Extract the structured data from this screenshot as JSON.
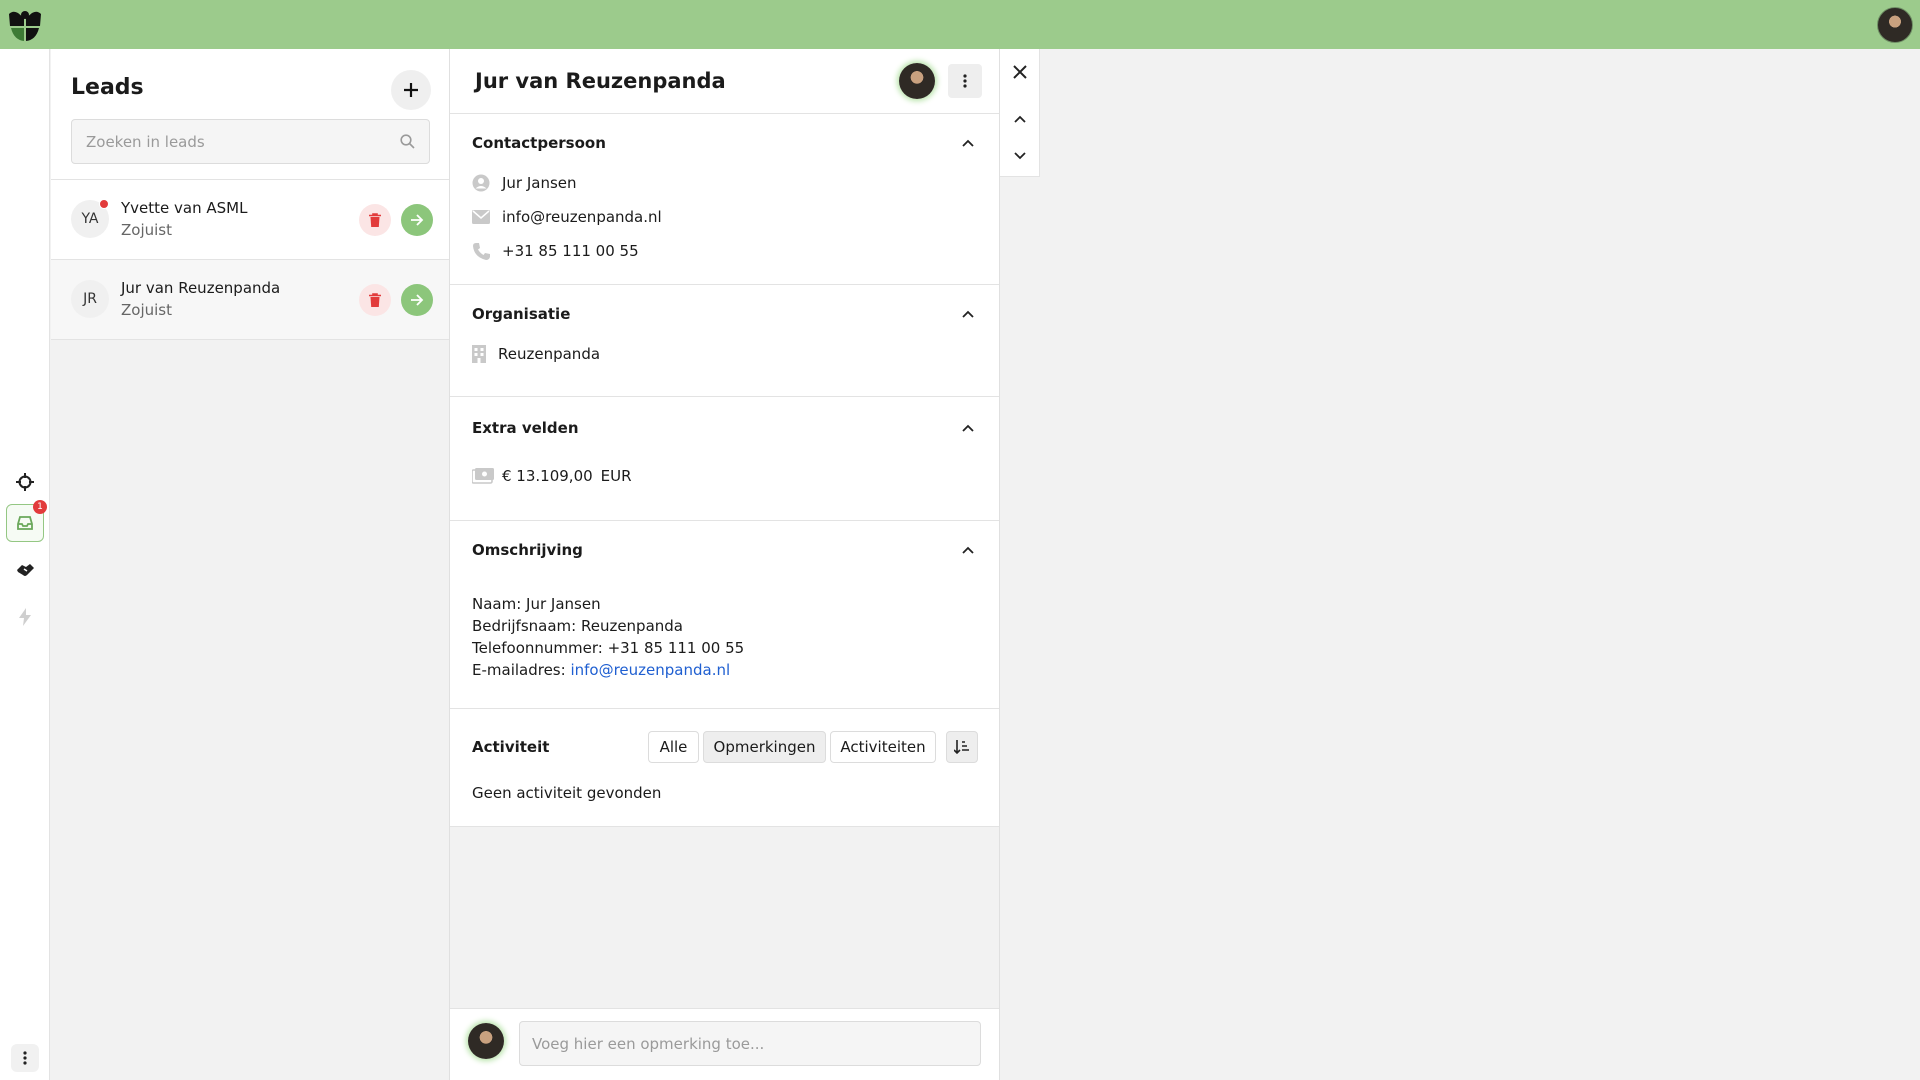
{
  "leads": {
    "title": "Leads",
    "search_placeholder": "Zoeken in leads",
    "items": [
      {
        "initials": "YA",
        "name": "Yvette van ASML",
        "time": "Zojuist",
        "unread": true
      },
      {
        "initials": "JR",
        "name": "Jur van Reuzenpanda",
        "time": "Zojuist",
        "unread": false
      }
    ]
  },
  "rail": {
    "inbox_badge": "1"
  },
  "detail": {
    "title": "Jur van Reuzenpanda",
    "contact": {
      "title": "Contactpersoon",
      "name": "Jur Jansen",
      "email": "info@reuzenpanda.nl",
      "phone": "+31 85 111 00 55"
    },
    "organisation": {
      "title": "Organisatie",
      "name": "Reuzenpanda"
    },
    "extra": {
      "title": "Extra velden",
      "amount": "€ 13.109,00",
      "currency": "EUR"
    },
    "description": {
      "title": "Omschrijving",
      "line1": "Naam: Jur Jansen",
      "line2": "Bedrijfsnaam: Reuzenpanda",
      "line3": "Telefoonnummer: +31 85 111 00 55",
      "line4_label": "E-mailadres: ",
      "line4_link": "info@reuzenpanda.nl"
    },
    "activity": {
      "title": "Activiteit",
      "filters": [
        "Alle",
        "Opmerkingen",
        "Activiteiten"
      ],
      "empty": "Geen activiteit gevonden"
    },
    "comment_placeholder": "Voeg hier een opmerking toe..."
  },
  "colors": {
    "topbar": "#9ccb8c",
    "accent_green": "#8cc67b",
    "danger": "#e23b3b",
    "link": "#1f5fd1"
  }
}
